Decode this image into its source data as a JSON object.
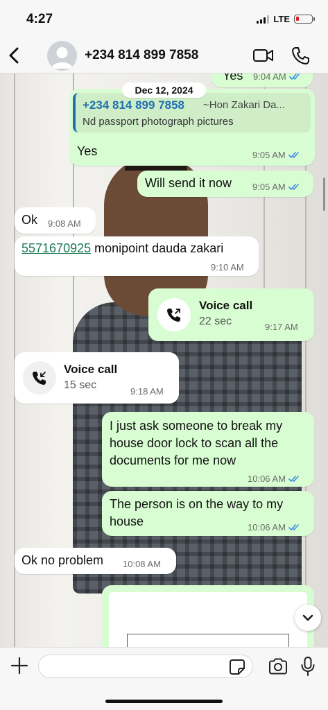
{
  "status_bar": {
    "time": "4:27",
    "network": "LTE",
    "battery_level": 0.18
  },
  "header": {
    "contact_name": "+234 814 899 7858",
    "icons": {
      "back": "chevron-left-icon",
      "avatar": "avatar-placeholder",
      "video": "video-camera-icon",
      "phone": "phone-icon"
    }
  },
  "chat": {
    "date_chip": "Dec 12, 2024",
    "messages": [
      {
        "id": "m0",
        "direction": "out",
        "text": "Yes",
        "time": "9:04 AM",
        "read": true
      },
      {
        "id": "m1",
        "direction": "out",
        "quote_name": "+234 814 899 7858",
        "quote_alias": "~Hon Zakari Da...",
        "quote_text": "Nd passport photograph pictures",
        "text": "Yes",
        "time": "9:05 AM",
        "read": true
      },
      {
        "id": "m2",
        "direction": "out",
        "text": "Will send it now",
        "time": "9:05 AM",
        "read": true
      },
      {
        "id": "m3",
        "direction": "in",
        "text": "Ok",
        "time": "9:08 AM"
      },
      {
        "id": "m4",
        "direction": "in",
        "link": "5571670925",
        "text": " monipoint dauda zakari",
        "time": "9:10 AM"
      },
      {
        "id": "m5",
        "direction": "out",
        "call_title": "Voice call",
        "call_duration": "22 sec",
        "call_type": "outgoing-call-icon",
        "time": "9:17 AM"
      },
      {
        "id": "m6",
        "direction": "in",
        "call_title": "Voice call",
        "call_duration": "15 sec",
        "call_type": "incoming-call-icon",
        "time": "9:18 AM"
      },
      {
        "id": "m7",
        "direction": "out",
        "lines": [
          "I just ask someone to break my",
          "house door lock to scan all the",
          "documents for me now"
        ],
        "time": "10:06 AM",
        "read": true
      },
      {
        "id": "m8",
        "direction": "out",
        "lines": [
          "The person is on the way to my",
          "house"
        ],
        "time": "10:06 AM",
        "read": true
      },
      {
        "id": "m9",
        "direction": "in",
        "text": "Ok no problem",
        "time": "10:08 AM"
      }
    ]
  },
  "composer": {
    "input_value": "",
    "input_placeholder": "",
    "icons": {
      "plus": "plus-icon",
      "sticker": "sticker-icon",
      "camera": "camera-icon",
      "mic": "microphone-icon"
    }
  },
  "colors": {
    "outgoing_bubble": "#d9fdd3",
    "incoming_bubble": "#ffffff",
    "read_ticks": "#3b8ee6",
    "link": "#1b7a54",
    "quote_name": "#1f6fb2"
  }
}
